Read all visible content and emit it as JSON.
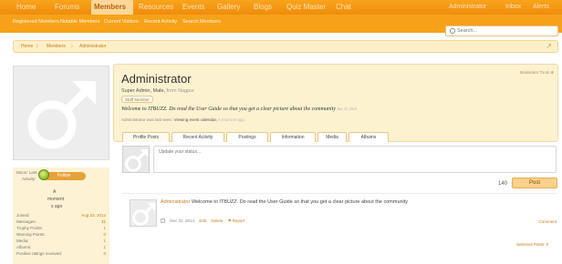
{
  "top_nav": {
    "tabs": [
      "Home",
      "Forums",
      "Members",
      "Resources",
      "Events",
      "Gallery",
      "Blogs",
      "Quiz Master",
      "Chat"
    ],
    "active": "Members",
    "user": "Administrator",
    "inbox": "Inbox",
    "alerts": "Alerts"
  },
  "sub_nav": {
    "links": [
      "Registered Members",
      "Notable Members",
      "Current Visitors",
      "Recent Activity",
      "Search Members"
    ]
  },
  "search": {
    "placeholder": "Search..."
  },
  "breadcrumb": [
    "Home",
    "Members",
    "Administrator"
  ],
  "profile": {
    "name": "Administrator",
    "title": "Super Admin, Male,",
    "from_label": "from",
    "location": "Nagpur",
    "badge": "Staff Member",
    "status": "Welcome to ITBUZZ. Do read the User Guide so that you get a clear picture about the community",
    "status_date": "Dec 31, 2014",
    "last_seen_prefix": "Administrator was last seen:",
    "last_seen_activity": "Viewing event calendar,",
    "last_seen_time": "A moment ago",
    "moderator_tools": "Moderator Tools"
  },
  "profile_tabs": [
    "Profile Posts",
    "Recent Activity",
    "Postings",
    "Information",
    "Media",
    "Albums"
  ],
  "sidebar": {
    "follow": "Follow",
    "last_activity_parts": [
      "Moon: Last",
      "Activity:",
      "A",
      "moment",
      "s ago"
    ],
    "stats": [
      {
        "k": "Joined:",
        "v": "Aug 23, 2014"
      },
      {
        "k": "Messages:",
        "v": "31"
      },
      {
        "k": "Trophy Points:",
        "v": "1"
      },
      {
        "k": "Warning Points:",
        "v": "0"
      },
      {
        "k": "Media:",
        "v": "1"
      },
      {
        "k": "Albums:",
        "v": "1"
      },
      {
        "k": "Positive ratings received:",
        "v": "0"
      }
    ]
  },
  "status_input": {
    "placeholder": "Update your status..."
  },
  "counter": "140",
  "post_button": "Post",
  "message": {
    "author": "Administrator",
    "text": "Welcome to ITBUZZ. Do read the User Guide so that you get a clear picture about the community",
    "date": "Dec 31, 2014",
    "edit": "Edit",
    "delete": "Delete",
    "report": "Report",
    "comment": "Comment"
  },
  "selected_posts": "Selected Posts: 0",
  "colors": {
    "orange": "#f59a16",
    "cream": "#fdf2d0",
    "link": "#c47c1a"
  }
}
